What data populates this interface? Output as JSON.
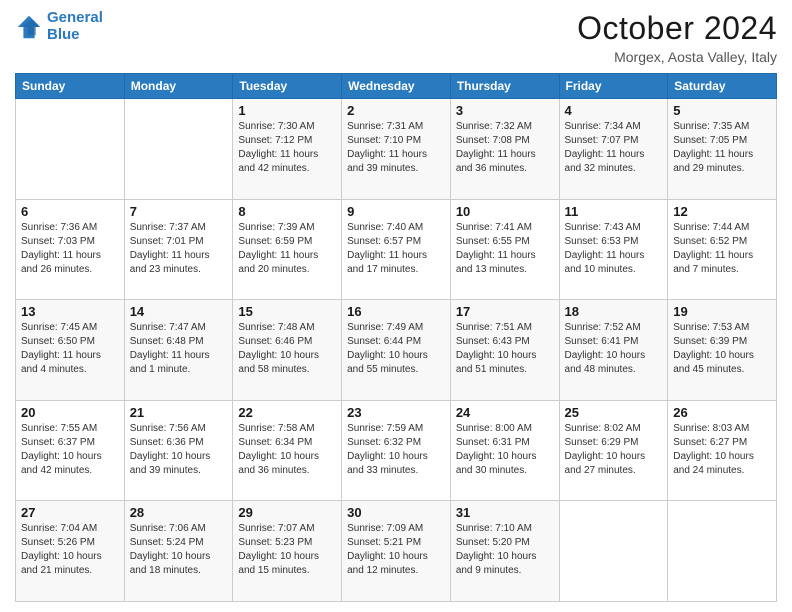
{
  "header": {
    "logo_text_general": "General",
    "logo_text_blue": "Blue",
    "month_title": "October 2024",
    "location": "Morgex, Aosta Valley, Italy"
  },
  "calendar": {
    "headers": [
      "Sunday",
      "Monday",
      "Tuesday",
      "Wednesday",
      "Thursday",
      "Friday",
      "Saturday"
    ],
    "weeks": [
      [
        {
          "day": "",
          "sunrise": "",
          "sunset": "",
          "daylight": ""
        },
        {
          "day": "",
          "sunrise": "",
          "sunset": "",
          "daylight": ""
        },
        {
          "day": "1",
          "sunrise": "Sunrise: 7:30 AM",
          "sunset": "Sunset: 7:12 PM",
          "daylight": "Daylight: 11 hours and 42 minutes."
        },
        {
          "day": "2",
          "sunrise": "Sunrise: 7:31 AM",
          "sunset": "Sunset: 7:10 PM",
          "daylight": "Daylight: 11 hours and 39 minutes."
        },
        {
          "day": "3",
          "sunrise": "Sunrise: 7:32 AM",
          "sunset": "Sunset: 7:08 PM",
          "daylight": "Daylight: 11 hours and 36 minutes."
        },
        {
          "day": "4",
          "sunrise": "Sunrise: 7:34 AM",
          "sunset": "Sunset: 7:07 PM",
          "daylight": "Daylight: 11 hours and 32 minutes."
        },
        {
          "day": "5",
          "sunrise": "Sunrise: 7:35 AM",
          "sunset": "Sunset: 7:05 PM",
          "daylight": "Daylight: 11 hours and 29 minutes."
        }
      ],
      [
        {
          "day": "6",
          "sunrise": "Sunrise: 7:36 AM",
          "sunset": "Sunset: 7:03 PM",
          "daylight": "Daylight: 11 hours and 26 minutes."
        },
        {
          "day": "7",
          "sunrise": "Sunrise: 7:37 AM",
          "sunset": "Sunset: 7:01 PM",
          "daylight": "Daylight: 11 hours and 23 minutes."
        },
        {
          "day": "8",
          "sunrise": "Sunrise: 7:39 AM",
          "sunset": "Sunset: 6:59 PM",
          "daylight": "Daylight: 11 hours and 20 minutes."
        },
        {
          "day": "9",
          "sunrise": "Sunrise: 7:40 AM",
          "sunset": "Sunset: 6:57 PM",
          "daylight": "Daylight: 11 hours and 17 minutes."
        },
        {
          "day": "10",
          "sunrise": "Sunrise: 7:41 AM",
          "sunset": "Sunset: 6:55 PM",
          "daylight": "Daylight: 11 hours and 13 minutes."
        },
        {
          "day": "11",
          "sunrise": "Sunrise: 7:43 AM",
          "sunset": "Sunset: 6:53 PM",
          "daylight": "Daylight: 11 hours and 10 minutes."
        },
        {
          "day": "12",
          "sunrise": "Sunrise: 7:44 AM",
          "sunset": "Sunset: 6:52 PM",
          "daylight": "Daylight: 11 hours and 7 minutes."
        }
      ],
      [
        {
          "day": "13",
          "sunrise": "Sunrise: 7:45 AM",
          "sunset": "Sunset: 6:50 PM",
          "daylight": "Daylight: 11 hours and 4 minutes."
        },
        {
          "day": "14",
          "sunrise": "Sunrise: 7:47 AM",
          "sunset": "Sunset: 6:48 PM",
          "daylight": "Daylight: 11 hours and 1 minute."
        },
        {
          "day": "15",
          "sunrise": "Sunrise: 7:48 AM",
          "sunset": "Sunset: 6:46 PM",
          "daylight": "Daylight: 10 hours and 58 minutes."
        },
        {
          "day": "16",
          "sunrise": "Sunrise: 7:49 AM",
          "sunset": "Sunset: 6:44 PM",
          "daylight": "Daylight: 10 hours and 55 minutes."
        },
        {
          "day": "17",
          "sunrise": "Sunrise: 7:51 AM",
          "sunset": "Sunset: 6:43 PM",
          "daylight": "Daylight: 10 hours and 51 minutes."
        },
        {
          "day": "18",
          "sunrise": "Sunrise: 7:52 AM",
          "sunset": "Sunset: 6:41 PM",
          "daylight": "Daylight: 10 hours and 48 minutes."
        },
        {
          "day": "19",
          "sunrise": "Sunrise: 7:53 AM",
          "sunset": "Sunset: 6:39 PM",
          "daylight": "Daylight: 10 hours and 45 minutes."
        }
      ],
      [
        {
          "day": "20",
          "sunrise": "Sunrise: 7:55 AM",
          "sunset": "Sunset: 6:37 PM",
          "daylight": "Daylight: 10 hours and 42 minutes."
        },
        {
          "day": "21",
          "sunrise": "Sunrise: 7:56 AM",
          "sunset": "Sunset: 6:36 PM",
          "daylight": "Daylight: 10 hours and 39 minutes."
        },
        {
          "day": "22",
          "sunrise": "Sunrise: 7:58 AM",
          "sunset": "Sunset: 6:34 PM",
          "daylight": "Daylight: 10 hours and 36 minutes."
        },
        {
          "day": "23",
          "sunrise": "Sunrise: 7:59 AM",
          "sunset": "Sunset: 6:32 PM",
          "daylight": "Daylight: 10 hours and 33 minutes."
        },
        {
          "day": "24",
          "sunrise": "Sunrise: 8:00 AM",
          "sunset": "Sunset: 6:31 PM",
          "daylight": "Daylight: 10 hours and 30 minutes."
        },
        {
          "day": "25",
          "sunrise": "Sunrise: 8:02 AM",
          "sunset": "Sunset: 6:29 PM",
          "daylight": "Daylight: 10 hours and 27 minutes."
        },
        {
          "day": "26",
          "sunrise": "Sunrise: 8:03 AM",
          "sunset": "Sunset: 6:27 PM",
          "daylight": "Daylight: 10 hours and 24 minutes."
        }
      ],
      [
        {
          "day": "27",
          "sunrise": "Sunrise: 7:04 AM",
          "sunset": "Sunset: 5:26 PM",
          "daylight": "Daylight: 10 hours and 21 minutes."
        },
        {
          "day": "28",
          "sunrise": "Sunrise: 7:06 AM",
          "sunset": "Sunset: 5:24 PM",
          "daylight": "Daylight: 10 hours and 18 minutes."
        },
        {
          "day": "29",
          "sunrise": "Sunrise: 7:07 AM",
          "sunset": "Sunset: 5:23 PM",
          "daylight": "Daylight: 10 hours and 15 minutes."
        },
        {
          "day": "30",
          "sunrise": "Sunrise: 7:09 AM",
          "sunset": "Sunset: 5:21 PM",
          "daylight": "Daylight: 10 hours and 12 minutes."
        },
        {
          "day": "31",
          "sunrise": "Sunrise: 7:10 AM",
          "sunset": "Sunset: 5:20 PM",
          "daylight": "Daylight: 10 hours and 9 minutes."
        },
        {
          "day": "",
          "sunrise": "",
          "sunset": "",
          "daylight": ""
        },
        {
          "day": "",
          "sunrise": "",
          "sunset": "",
          "daylight": ""
        }
      ]
    ]
  }
}
